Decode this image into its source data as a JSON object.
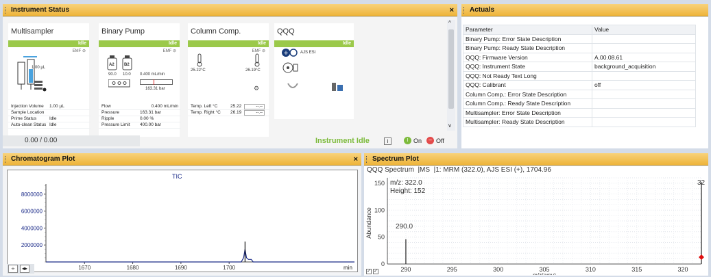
{
  "instrument_status": {
    "title": "Instrument Status",
    "close": "×",
    "modules": [
      {
        "name": "Multisampler",
        "status": "Idle",
        "emf": "EMF",
        "volume_display": "1.00 µL",
        "rows": [
          {
            "k": "Injection Volume",
            "v": "1.00 µL"
          },
          {
            "k": "Sample Location",
            "v": ""
          },
          {
            "k": "Prime Status",
            "v": "Idle"
          },
          {
            "k": "Auto-clean Status",
            "v": "Idle"
          }
        ]
      },
      {
        "name": "Binary Pump",
        "status": "Idle",
        "emf": "EMF",
        "bottle_a": "A2",
        "bottle_b": "B2",
        "pct_a": "90.0",
        "pct_b": "10.0",
        "flow_display": "0.400 mL/min",
        "pressure_display": "163.31 bar",
        "rows": [
          {
            "k": "Flow",
            "v": "0.400 mL/min"
          },
          {
            "k": "Pressure",
            "v": "163.31 bar"
          },
          {
            "k": "Ripple",
            "v": "0.00 %"
          },
          {
            "k": "Pressure Limit",
            "v": "400.00 bar"
          }
        ]
      },
      {
        "name": "Column Comp.",
        "status": "Idle",
        "emf": "EMF",
        "temp_left_display": "25.22°C",
        "temp_right_display": "26.19°C",
        "rows": [
          {
            "k": "Temp. Left °C",
            "v": "25.22",
            "v2": "--.--"
          },
          {
            "k": "Temp. Right °C",
            "v": "26.19",
            "v2": "--.--"
          }
        ]
      },
      {
        "name": "QQQ",
        "status": "Idle",
        "source": "AJS ESI"
      }
    ],
    "progress": "0.00 / 0.00",
    "instrument_state": "Instrument Idle",
    "info_btn": "i",
    "on_label": "On",
    "off_label": "Off"
  },
  "actuals": {
    "title": "Actuals",
    "headers": [
      "Parameter",
      "Value"
    ],
    "rows": [
      [
        "Binary Pump:  Error State Description",
        ""
      ],
      [
        "Binary Pump:  Ready State Description",
        ""
      ],
      [
        "QQQ:  Firmware Version",
        "A.00.08.61"
      ],
      [
        "QQQ:  Instrument State",
        "background_acquisition"
      ],
      [
        "QQQ:  Not Ready Text Long",
        ""
      ],
      [
        "QQQ:  Calibrant",
        "off"
      ],
      [
        "Column Comp.:  Error State Description",
        ""
      ],
      [
        "Column Comp.:  Ready State Description",
        ""
      ],
      [
        "Multisampler:  Error State Description",
        ""
      ],
      [
        "Multisampler:  Ready State Description",
        ""
      ]
    ]
  },
  "chromatogram": {
    "title": "Chromatogram Plot",
    "close": "×",
    "trace_label": "TIC",
    "x_unit": "min"
  },
  "spectrum": {
    "title": "Spectrum Plot",
    "header": "QQQ Spectrum  |MS  |1: MRM (322.0), AJS ESI (+), 1704.96",
    "cursor_mz": "m/z: 322.0",
    "cursor_height": "Height: 152",
    "peak_label": "290.0",
    "edge_label": "32"
  },
  "chart_data": [
    {
      "type": "line",
      "title": "TIC",
      "xlabel": "min",
      "ylabel": "",
      "xlim": [
        1662,
        1726
      ],
      "ylim": [
        0,
        9200000
      ],
      "x_ticks": [
        "1670",
        "1680",
        "1690",
        "1700"
      ],
      "y_ticks": [
        "2000000",
        "4000000",
        "6000000",
        "8000000"
      ],
      "series": [
        {
          "x": [
            1662,
            1702.5,
            1702.8,
            1703.0,
            1703.3,
            1703.6,
            1704.0,
            1704.3,
            1704.6,
            1705.0,
            1726
          ],
          "values": [
            0,
            0,
            300000,
            500000,
            1500000,
            500000,
            300000,
            300000,
            300000,
            0,
            0
          ]
        }
      ],
      "grid": false,
      "color": "#1a2a88"
    },
    {
      "type": "bar",
      "title": "",
      "xlabel": "m/z(amu)",
      "ylabel": "Abundance",
      "xlim": [
        288,
        322
      ],
      "ylim": [
        0,
        160
      ],
      "x_ticks": [
        "290",
        "295",
        "300",
        "305",
        "310",
        "315",
        "320"
      ],
      "y_ticks": [
        "0",
        "50",
        "100",
        "150"
      ],
      "x": [
        290.0,
        322.0
      ],
      "values": [
        46,
        152
      ],
      "grid": true,
      "color": "#222222",
      "marker_color": "#e01010"
    }
  ]
}
